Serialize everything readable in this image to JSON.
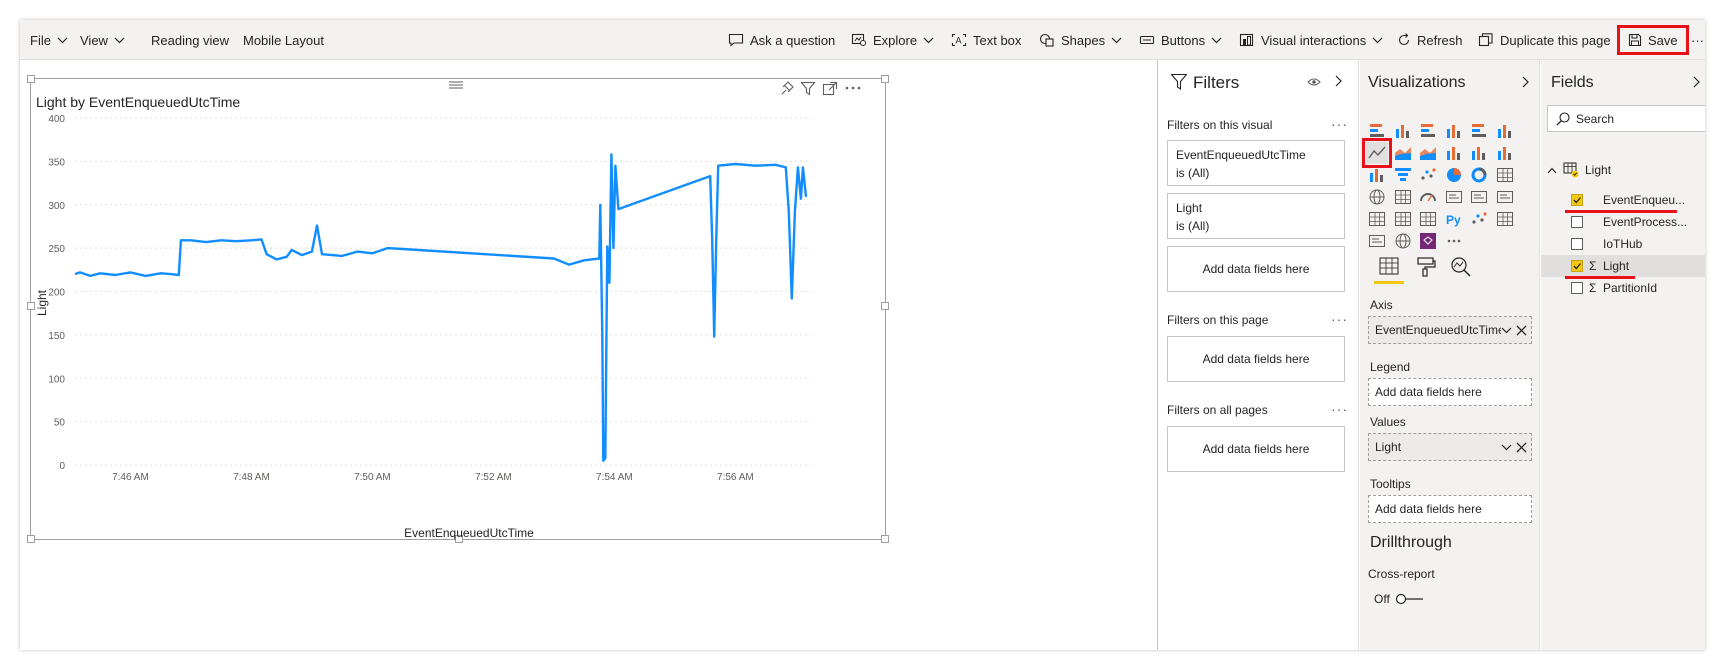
{
  "toolbar": {
    "file": "File",
    "view": "View",
    "reading_view": "Reading view",
    "mobile_layout": "Mobile Layout",
    "ask_question": "Ask a question",
    "explore": "Explore",
    "text_box": "Text box",
    "shapes": "Shapes",
    "buttons": "Buttons",
    "visual_interactions": "Visual interactions",
    "refresh": "Refresh",
    "duplicate_page": "Duplicate this page",
    "save": "Save",
    "more": "···"
  },
  "visual": {
    "title": "Light by EventEnqueuedUtcTime",
    "xlabel": "EventEnqueuedUtcTime",
    "ylabel": "Light"
  },
  "chart_data": {
    "type": "line",
    "title": "Light by EventEnqueuedUtcTime",
    "xlabel": "EventEnqueuedUtcTime",
    "ylabel": "Light",
    "ylim": [
      0,
      400
    ],
    "yticks": [
      0,
      50,
      100,
      150,
      200,
      250,
      300,
      350,
      400
    ],
    "xlim": [
      "7:45:05",
      "7:57:15"
    ],
    "xticks": [
      {
        "t": "7:46:00",
        "label": "7:46 AM"
      },
      {
        "t": "7:48:00",
        "label": "7:48 AM"
      },
      {
        "t": "7:50:00",
        "label": "7:50 AM"
      },
      {
        "t": "7:52:00",
        "label": "7:52 AM"
      },
      {
        "t": "7:54:00",
        "label": "7:54 AM"
      },
      {
        "t": "7:56:00",
        "label": "7:56 AM"
      }
    ],
    "grid": true,
    "series": [
      {
        "color": "#118dff",
        "points": [
          [
            "7:45:05",
            220
          ],
          [
            "7:45:10",
            222
          ],
          [
            "7:45:20",
            218
          ],
          [
            "7:45:30",
            221
          ],
          [
            "7:45:45",
            219
          ],
          [
            "7:46:00",
            222
          ],
          [
            "7:46:15",
            218
          ],
          [
            "7:46:30",
            221
          ],
          [
            "7:46:40",
            220
          ],
          [
            "7:46:48",
            219
          ],
          [
            "7:46:50",
            259
          ],
          [
            "7:47:00",
            259
          ],
          [
            "7:47:15",
            257
          ],
          [
            "7:47:30",
            259
          ],
          [
            "7:47:45",
            258
          ],
          [
            "7:48:00",
            259
          ],
          [
            "7:48:10",
            260
          ],
          [
            "7:48:15",
            243
          ],
          [
            "7:48:25",
            237
          ],
          [
            "7:48:35",
            240
          ],
          [
            "7:48:40",
            248
          ],
          [
            "7:48:50",
            242
          ],
          [
            "7:49:00",
            246
          ],
          [
            "7:49:05",
            276
          ],
          [
            "7:49:10",
            243
          ],
          [
            "7:49:20",
            242
          ],
          [
            "7:49:30",
            241
          ],
          [
            "7:49:45",
            246
          ],
          [
            "7:50:00",
            244
          ],
          [
            "7:50:15",
            250
          ],
          [
            "7:50:30",
            249
          ],
          [
            "7:53:00",
            238
          ],
          [
            "7:53:15",
            231
          ],
          [
            "7:53:30",
            236
          ],
          [
            "7:53:45",
            238
          ],
          [
            "7:53:46",
            300
          ],
          [
            "7:53:48",
            150
          ],
          [
            "7:53:49",
            5
          ],
          [
            "7:53:51",
            8
          ],
          [
            "7:53:53",
            252
          ],
          [
            "7:53:55",
            210
          ],
          [
            "7:53:57",
            358
          ],
          [
            "7:53:59",
            250
          ],
          [
            "7:54:01",
            345
          ],
          [
            "7:54:04",
            295
          ],
          [
            "7:55:35",
            333
          ],
          [
            "7:55:37",
            260
          ],
          [
            "7:55:39",
            148
          ],
          [
            "7:55:41",
            258
          ],
          [
            "7:55:43",
            345
          ],
          [
            "7:56:00",
            347
          ],
          [
            "7:56:20",
            345
          ],
          [
            "7:56:40",
            346
          ],
          [
            "7:56:50",
            343
          ],
          [
            "7:56:53",
            292
          ],
          [
            "7:56:56",
            192
          ],
          [
            "7:56:59",
            292
          ],
          [
            "7:57:02",
            343
          ],
          [
            "7:57:05",
            307
          ],
          [
            "7:57:07",
            343
          ],
          [
            "7:57:10",
            309
          ]
        ]
      }
    ]
  },
  "filters": {
    "title": "Filters",
    "on_visual": "Filters on this visual",
    "card1_field": "EventEnqueuedUtcTime",
    "card1_value": "is (All)",
    "card2_field": "Light",
    "card2_value": "is (All)",
    "add_fields": "Add data fields here",
    "on_page": "Filters on this page",
    "on_all": "Filters on all pages"
  },
  "viz": {
    "title": "Visualizations",
    "py_label": "Py",
    "more": "···",
    "axis_label": "Axis",
    "axis_value": "EventEnqueuedUtcTime",
    "legend_label": "Legend",
    "legend_placeholder": "Add data fields here",
    "values_label": "Values",
    "values_value": "Light",
    "tooltips_label": "Tooltips",
    "tooltips_placeholder": "Add data fields here",
    "drillthrough": "Drillthrough",
    "cross_report": "Cross-report",
    "off": "Off"
  },
  "fields": {
    "title": "Fields",
    "search_placeholder": "Search",
    "table_name": "Light",
    "items": [
      {
        "name": "EventEnqueu...",
        "checked": true,
        "sigma": false
      },
      {
        "name": "EventProcess...",
        "checked": false,
        "sigma": false
      },
      {
        "name": "IoTHub",
        "checked": false,
        "sigma": false
      },
      {
        "name": "Light",
        "checked": true,
        "sigma": true
      },
      {
        "name": "PartitionId",
        "checked": false,
        "sigma": true
      }
    ],
    "sigma_symbol": "Σ"
  },
  "colors": {
    "line": "#118dff",
    "highlight_red": "#e8111a",
    "accent_yellow": "#f2c811"
  }
}
